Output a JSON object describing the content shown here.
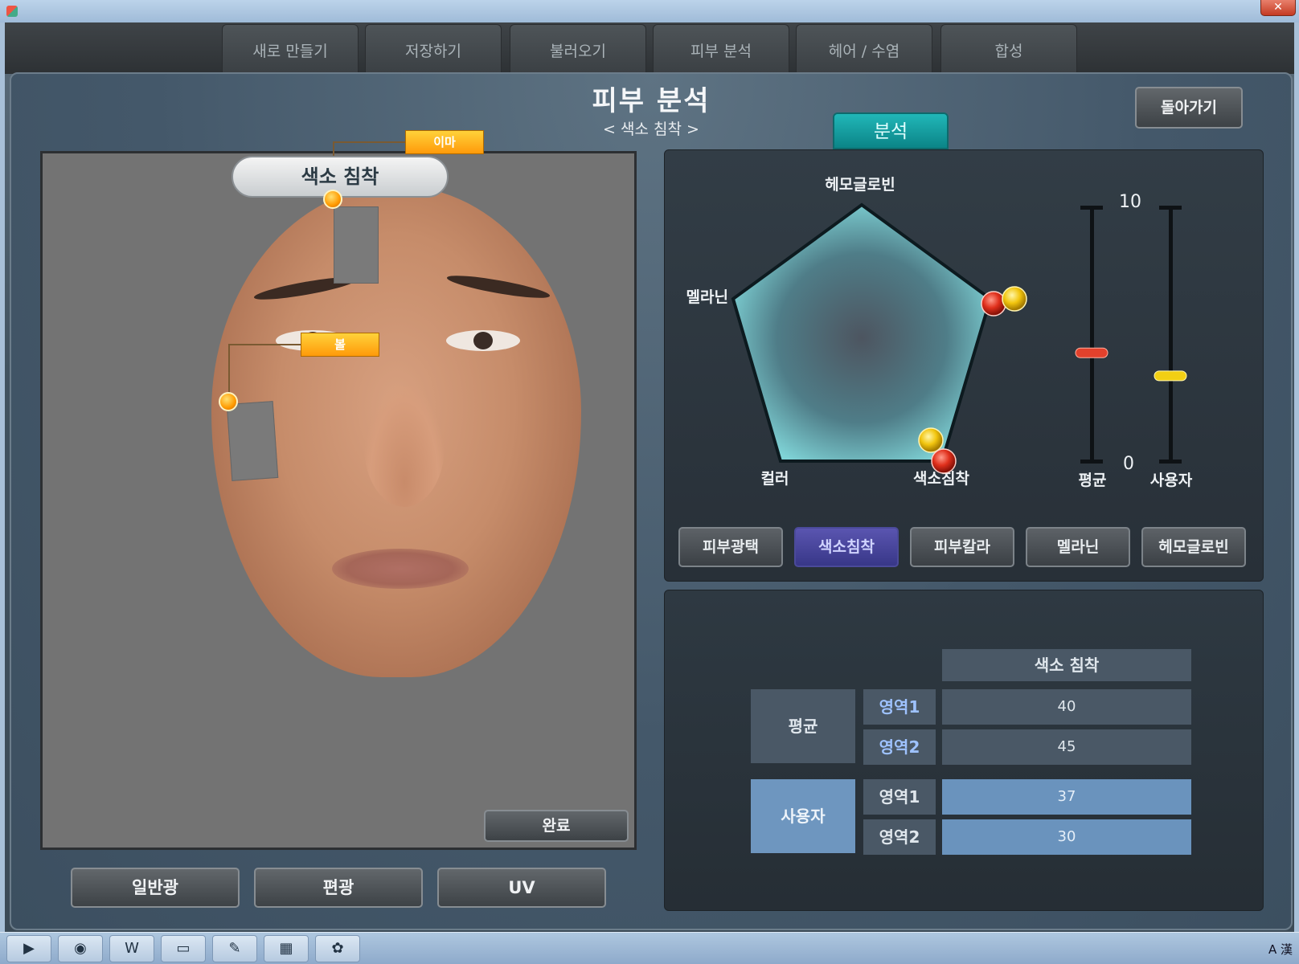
{
  "window": {
    "close_glyph": "✕"
  },
  "menu": {
    "tabs": [
      "새로 만들기",
      "저장하기",
      "불러오기",
      "피부 분석",
      "헤어 / 수염",
      "합성"
    ]
  },
  "header": {
    "title": "피부 분석",
    "subtitle": "< 색소 침착 >",
    "back_label": "돌아가기"
  },
  "viewer": {
    "bubble_label": "색소 침착",
    "tags": {
      "forehead": "이마",
      "cheek": "볼"
    },
    "done_label": "완료",
    "light_modes": [
      "일반광",
      "편광",
      "UV"
    ]
  },
  "analysis": {
    "tab_label": "분석",
    "radar": {
      "labels": [
        "헤모글로빈",
        "",
        "색소침착",
        "컬러",
        "멜라닌"
      ]
    },
    "sliders": {
      "max_label": "10",
      "min_label": "0",
      "average_label": "평균",
      "user_label": "사용자",
      "average_value": 4.3,
      "user_value": 3.4
    },
    "metric_buttons": [
      "피부광택",
      "색소침착",
      "피부칼라",
      "멜라닌",
      "헤모글로빈"
    ],
    "active_metric": "색소침착"
  },
  "results": {
    "column_header": "색소 침착",
    "average": {
      "label": "평균",
      "rows": [
        {
          "area": "영역1",
          "value": "40"
        },
        {
          "area": "영역2",
          "value": "45"
        }
      ]
    },
    "user": {
      "label": "사용자",
      "rows": [
        {
          "area": "영역1",
          "value": "37"
        },
        {
          "area": "영역2",
          "value": "30"
        }
      ]
    }
  },
  "taskbar": {
    "icons": [
      "media-player-icon",
      "chrome-icon",
      "word-icon",
      "monitor-icon",
      "app-icon",
      "office-icon",
      "paint-icon"
    ],
    "tray": "A 漢"
  },
  "colors": {
    "accent": "#0f9a9c",
    "active": "#4a47a0",
    "tag": "#ffb21a"
  }
}
